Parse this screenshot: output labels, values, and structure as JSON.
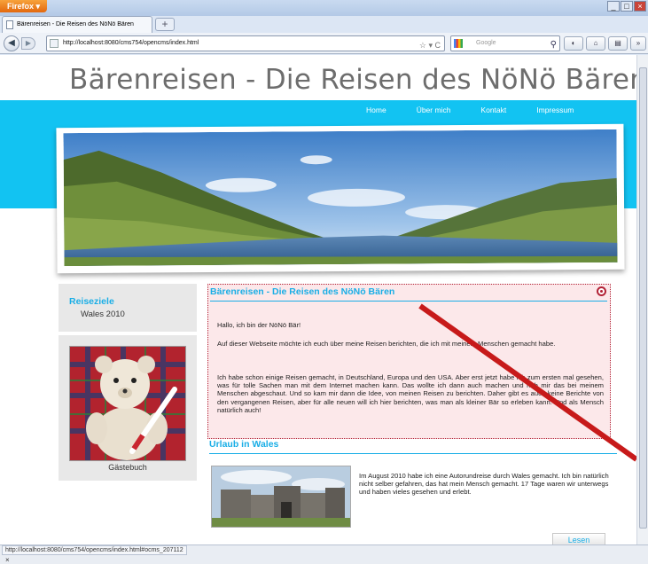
{
  "browser": {
    "app_button": "Firefox",
    "tab_title": "Bärenreisen - Die Reisen des NöNö Bären",
    "url": "http://localhost:8080/cms754/opencms/index.html",
    "search_placeholder": "Google",
    "status_url": "http://localhost:8080/cms754/opencms/index.html#ocms_207112",
    "status_close": "×"
  },
  "site": {
    "title": "Bärenreisen - Die Reisen des NöNö Bären",
    "nav": [
      "Home",
      "Über mich",
      "Kontakt",
      "Impressum"
    ]
  },
  "sidebar": {
    "heading": "Reiseziele",
    "items": [
      "Wales 2010"
    ],
    "guestbook_label": "Gästebuch"
  },
  "intro": {
    "title": "Bärenreisen - Die Reisen des NöNö Bären",
    "greeting": "Hallo, ich bin der NöNö Bär!",
    "para1": "Auf dieser Webseite möchte ich euch über meine Reisen berichten, die ich mit meinem Menschen gemacht habe.",
    "para2": "Ich habe schon einige Reisen gemacht, in Deutschland, Europa und den USA. Aber erst jetzt habe ich zum ersten mal gesehen, was für tolle Sachen man mit dem Internet machen kann. Das wollte ich dann auch machen und hab mir das bei meinem Menschen abgeschaut. Und so kam mir dann die Idee, von meinen Reisen zu berichten. Daher gibt es auch keine Berichte von den vergangenen Reisen, aber für alle neuen will ich hier berichten, was man als kleiner Bär so erleben kann. Und als Mensch natürlich auch!"
  },
  "wales": {
    "title": "Urlaub in Wales",
    "text": "Im August 2010 habe ich eine Autorundreise durch Wales gemacht. Ich bin natürlich nicht selber gefahren, das hat mein Mensch gemacht. 17 Tage waren wir unterwegs und haben vieles gesehen und erlebt.",
    "button_label": "Lesen"
  },
  "colors": {
    "accent": "#1aaee6",
    "band": "#12c3f2",
    "annotation_red": "#b22236"
  }
}
